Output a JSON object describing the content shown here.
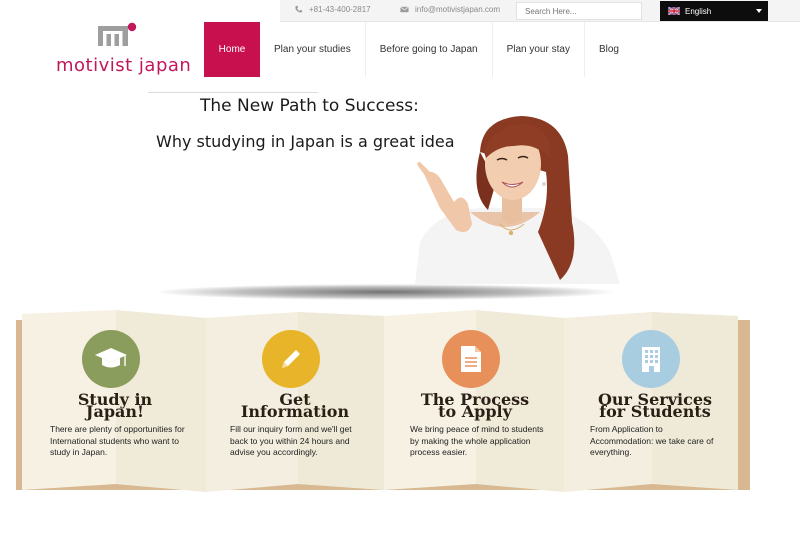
{
  "topbar": {
    "phone": "+81-43-400-2817",
    "email": "info@motivistjapan.com",
    "search_placeholder": "Search Here...",
    "language": "English",
    "icons": [
      "phone-icon",
      "envelope-icon",
      "uk-flag-icon",
      "caret-down-icon"
    ]
  },
  "logo": {
    "text": "motivist japan",
    "brand_color": "#c2185b",
    "mark_color": "#9e9e9e"
  },
  "nav": {
    "items": [
      {
        "label": "Home",
        "active": true
      },
      {
        "label": "Plan your studies",
        "active": false
      },
      {
        "label": "Before going to Japan",
        "active": false
      },
      {
        "label": "Plan your stay",
        "active": false
      },
      {
        "label": "Blog",
        "active": false
      }
    ],
    "active_color": "#c8104f"
  },
  "hero": {
    "title": "The New Path to Success:",
    "subtitle": "Why studying in Japan is a great idea"
  },
  "services": {
    "panel_color": "#f5f1e6",
    "cards": [
      {
        "title_lines": [
          "Study in",
          "Japan!"
        ],
        "body": "There are plenty of opportunities for International students who want to study in Japan.",
        "icon": "graduation-cap-icon",
        "color": "#8a9d5c"
      },
      {
        "title_lines": [
          "Get",
          "Information"
        ],
        "body": "Fill our inquiry form and we'll get back to you within 24 hours and advise you accordingly.",
        "icon": "pencil-icon",
        "color": "#e8b52a"
      },
      {
        "title_lines": [
          "The Process",
          "to Apply"
        ],
        "body": "We bring peace of mind to students by making the whole application process easier.",
        "icon": "document-icon",
        "color": "#e8905a"
      },
      {
        "title_lines": [
          "Our Services",
          "for Students"
        ],
        "body": "From Application to Accommodation: we take care of everything.",
        "icon": "building-icon",
        "color": "#a9cde0"
      }
    ]
  }
}
